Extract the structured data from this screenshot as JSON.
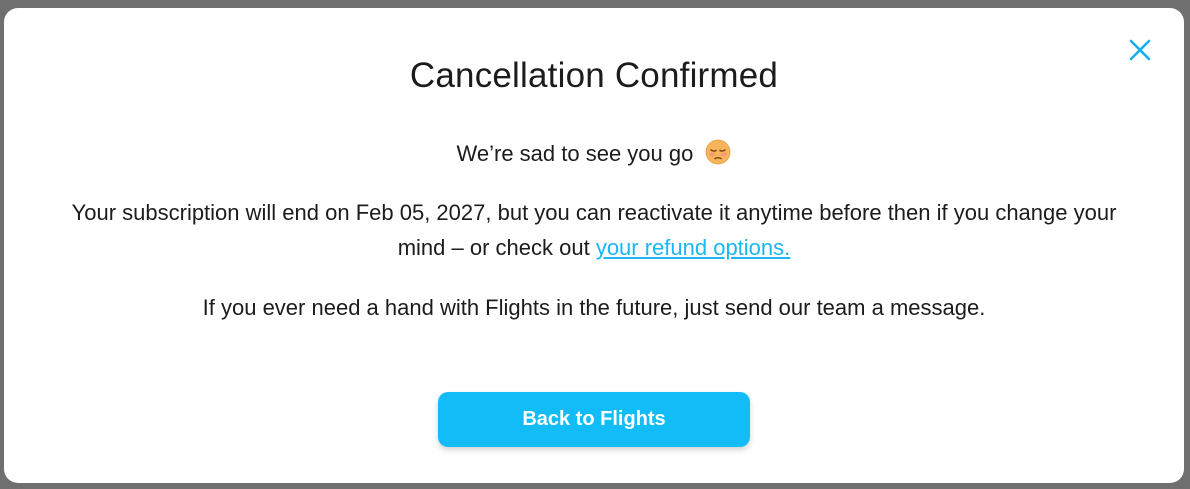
{
  "modal": {
    "title": "Cancellation Confirmed",
    "sad_text": "We’re sad to see you go",
    "sad_emoji": "pensive-face-emoji",
    "subscription_text": "Your subscription will end on Feb 05, 2027, but you can reactivate it anytime before then if you change your mind – or check out",
    "refund_link": "your refund options.",
    "help_text": "If you ever need a hand with Flights in the future, just send our team a message.",
    "button_label": "Back to Flights",
    "close_icon": "close-icon"
  },
  "colors": {
    "accent": "#12bdf7",
    "link": "#1cb6f2",
    "close": "#1aaeee",
    "text": "#1c1c1c",
    "overlay": "#6f6f6f"
  }
}
